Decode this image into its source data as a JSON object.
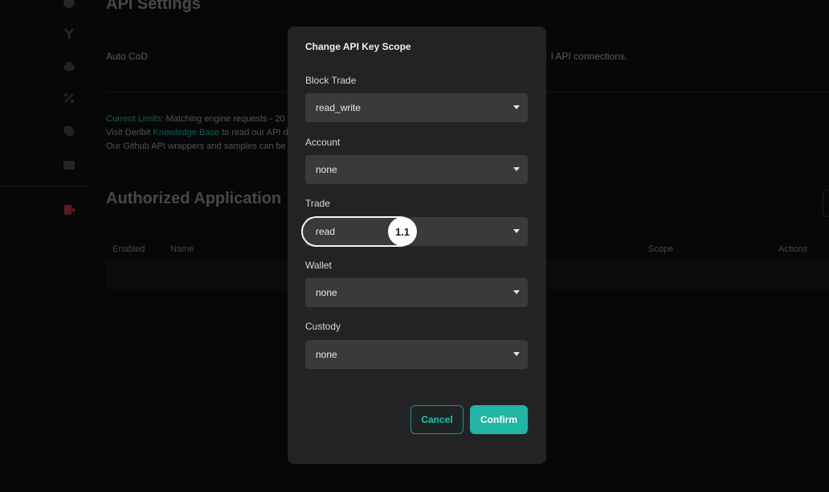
{
  "background": {
    "page_title": "API Settings",
    "auto_cod_label": "Auto CoD",
    "api_connections_text": "l API connections.",
    "limits": {
      "line1_prefix": "Current Limits",
      "line1_rest": ": Matching engine requests - 20",
      "line2_prefix": "Visit Deribit ",
      "line2_link": "Knowledge Base",
      "line2_rest": " to read our API d",
      "line3": "Our Github API wrappers and samples can be"
    },
    "authorized_title": "Authorized Application",
    "table_headers": [
      "Enabled",
      "Name",
      "Scope",
      "Actions"
    ]
  },
  "sidebar_icons": [
    "shield-icon",
    "fork-icon",
    "cloud-icon",
    "percent-icon",
    "copy-icon",
    "wallet-icon",
    "logout-icon"
  ],
  "modal": {
    "title": "Change API Key Scope",
    "fields": [
      {
        "label": "Block Trade",
        "value": "read_write"
      },
      {
        "label": "Account",
        "value": "none"
      },
      {
        "label": "Trade",
        "value": "read"
      },
      {
        "label": "Wallet",
        "value": "none"
      },
      {
        "label": "Custody",
        "value": "none"
      }
    ],
    "step_badge": "1.1",
    "cancel_label": "Cancel",
    "confirm_label": "Confirm"
  },
  "colors": {
    "accent": "#1fb6a6",
    "modal_bg": "#232325",
    "select_bg": "#3a3a3d"
  }
}
